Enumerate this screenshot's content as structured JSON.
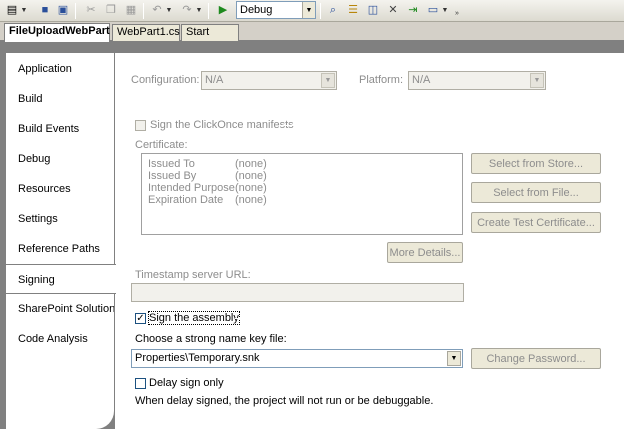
{
  "toolbar": {
    "config_value": "Debug",
    "icons": [
      "add-item-icon",
      "save-icon",
      "save-all-icon",
      "cut-icon",
      "copy-icon",
      "paste-icon",
      "undo-icon",
      "redo-icon",
      "start-debug-icon",
      "find-icon",
      "properties-icon",
      "object-browser-icon",
      "toolbox-icon",
      "publish-icon",
      "window-icon",
      "overflow-icon"
    ]
  },
  "tabs": [
    {
      "label": "FileUploadWebPart",
      "active": true
    },
    {
      "label": "WebPart1.cs",
      "active": false
    },
    {
      "label": "Start Page",
      "active": false
    }
  ],
  "nav": {
    "items": [
      {
        "label": "Application"
      },
      {
        "label": "Build"
      },
      {
        "label": "Build Events"
      },
      {
        "label": "Debug"
      },
      {
        "label": "Resources"
      },
      {
        "label": "Settings"
      },
      {
        "label": "Reference Paths"
      },
      {
        "label": "Signing",
        "selected": true
      },
      {
        "label": "SharePoint Solution"
      },
      {
        "label": "Code Analysis"
      }
    ]
  },
  "signing": {
    "configuration_label": "Configuration:",
    "configuration_value": "N/A",
    "platform_label": "Platform:",
    "platform_value": "N/A",
    "clickonce_label": "Sign the ClickOnce manifests",
    "certificate_label": "Certificate:",
    "certificate_rows": [
      {
        "key": "Issued To",
        "value": "(none)"
      },
      {
        "key": "Issued By",
        "value": "(none)"
      },
      {
        "key": "Intended Purpose",
        "value": "(none)"
      },
      {
        "key": "Expiration Date",
        "value": "(none)"
      }
    ],
    "select_from_store": "Select from Store...",
    "select_from_file": "Select from File...",
    "create_test_cert": "Create Test Certificate...",
    "more_details": "More Details...",
    "timestamp_label": "Timestamp server URL:",
    "timestamp_value": "",
    "sign_assembly_label": "Sign the assembly",
    "sign_assembly_checked": true,
    "key_file_label": "Choose a strong name key file:",
    "key_file_value": "Properties\\Temporary.snk",
    "change_password": "Change Password...",
    "delay_sign_label": "Delay sign only",
    "delay_sign_note": "When delay signed, the project will not run or be debuggable."
  }
}
